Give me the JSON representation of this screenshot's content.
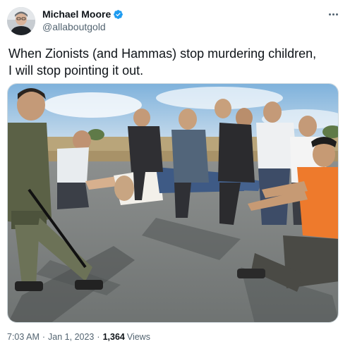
{
  "author": {
    "display_name": "Michael Moore",
    "handle": "@allaboutgold",
    "verified": true,
    "verified_icon": "verified-badge-icon",
    "avatar_icon": "profile-avatar"
  },
  "tweet": {
    "text_lines": [
      "When Zionists (and Hammas) stop murdering children,",
      "I will stop pointing it out."
    ],
    "media": {
      "kind": "photo"
    }
  },
  "meta": {
    "time": "7:03 AM",
    "separator": "·",
    "date": "Jan 1, 2023",
    "views_count": "1,364",
    "views_label": "Views"
  },
  "colors": {
    "text_primary": "#0f1419",
    "text_secondary": "#536471",
    "verified_blue": "#1d9bf0",
    "border": "#cfd9de"
  },
  "icons": {
    "more": "more-horizontal-icon"
  }
}
